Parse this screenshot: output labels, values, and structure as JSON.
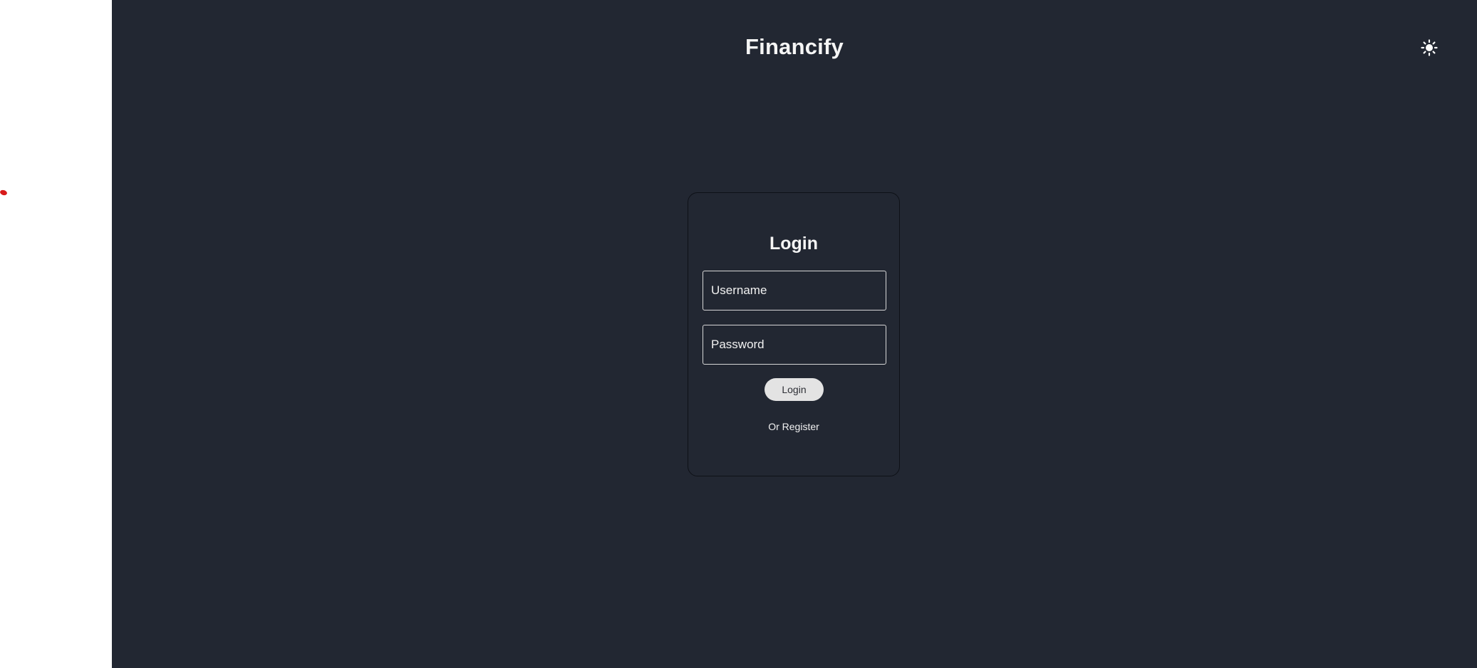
{
  "header": {
    "app_title": "Financify",
    "theme_toggle_icon": "sun-icon"
  },
  "login": {
    "heading": "Login",
    "username_placeholder": "Username",
    "username_value": "",
    "password_placeholder": "Password",
    "password_value": "",
    "submit_label": "Login",
    "register_link": "Or Register"
  },
  "colors": {
    "app_background": "#222732",
    "card_border": "#0e1117",
    "text": "#f5f5f5",
    "button_background": "#e3e3e3",
    "left_strip": "#ffffff",
    "red_mark": "#d81b1b"
  }
}
